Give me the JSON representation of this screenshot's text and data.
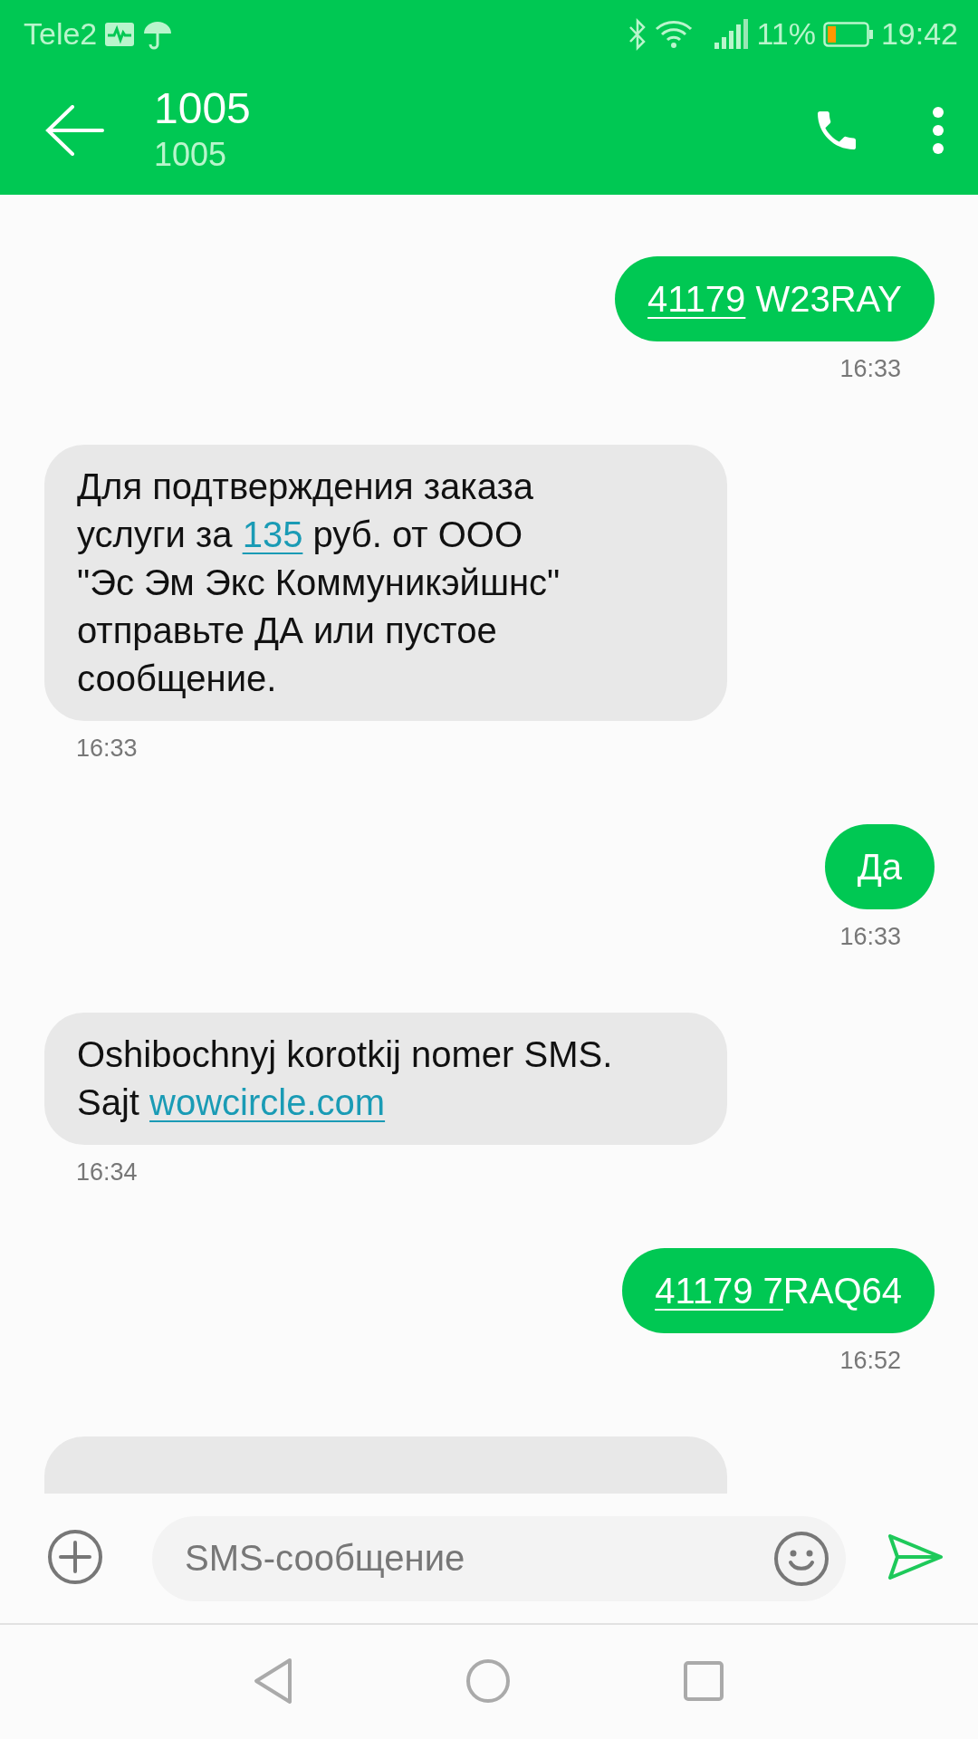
{
  "status_bar": {
    "carrier": "Tele2",
    "battery_percent": "11%",
    "time": "19:42"
  },
  "header": {
    "title": "1005",
    "subtitle": "1005"
  },
  "messages": [
    {
      "kind": "outgoing",
      "parts": [
        {
          "text": "41179",
          "link": true
        },
        {
          "text": " W23RAY",
          "link": false
        }
      ],
      "time": "16:33"
    },
    {
      "kind": "incoming",
      "parts": [
        {
          "text": "Для подтверждения заказа\nуслуги за ",
          "link": false
        },
        {
          "text": "135",
          "link": true
        },
        {
          "text": " руб. от ООО\n\"Эс Эм Экс Коммуникэйшнс\"\nотправьте ДА или пустое\nсообщение.",
          "link": false
        }
      ],
      "time": "16:33"
    },
    {
      "kind": "outgoing",
      "parts": [
        {
          "text": "Да",
          "link": false
        }
      ],
      "time": "16:33"
    },
    {
      "kind": "incoming",
      "parts": [
        {
          "text": "Oshibochnyj korotkij nomer SMS.\nSajt ",
          "link": false
        },
        {
          "text": "wowcircle.com",
          "link": true
        }
      ],
      "time": "16:34"
    },
    {
      "kind": "outgoing",
      "parts": [
        {
          "text": "41179 7",
          "link": true
        },
        {
          "text": "RAQ64",
          "link": false
        }
      ],
      "time": "16:52"
    },
    {
      "kind": "incoming_cut"
    }
  ],
  "composer": {
    "placeholder": "SMS-сообщение"
  }
}
